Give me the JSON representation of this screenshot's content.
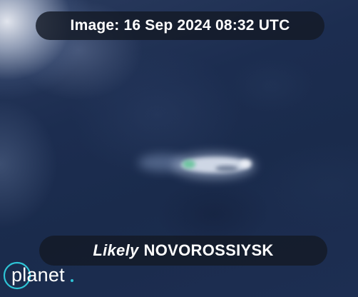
{
  "image_date_label": "Image: 16 Sep 2024 08:32 UTC",
  "caption": {
    "qualifier": "Likely",
    "vessel_name": "NOVOROSSIYSK"
  },
  "logo": {
    "text": "planet",
    "accent_color": "#2ec4d6"
  },
  "colors": {
    "sea": "#1c2d50",
    "cloud": "#e8ebf2",
    "overlay": "#141a26"
  }
}
